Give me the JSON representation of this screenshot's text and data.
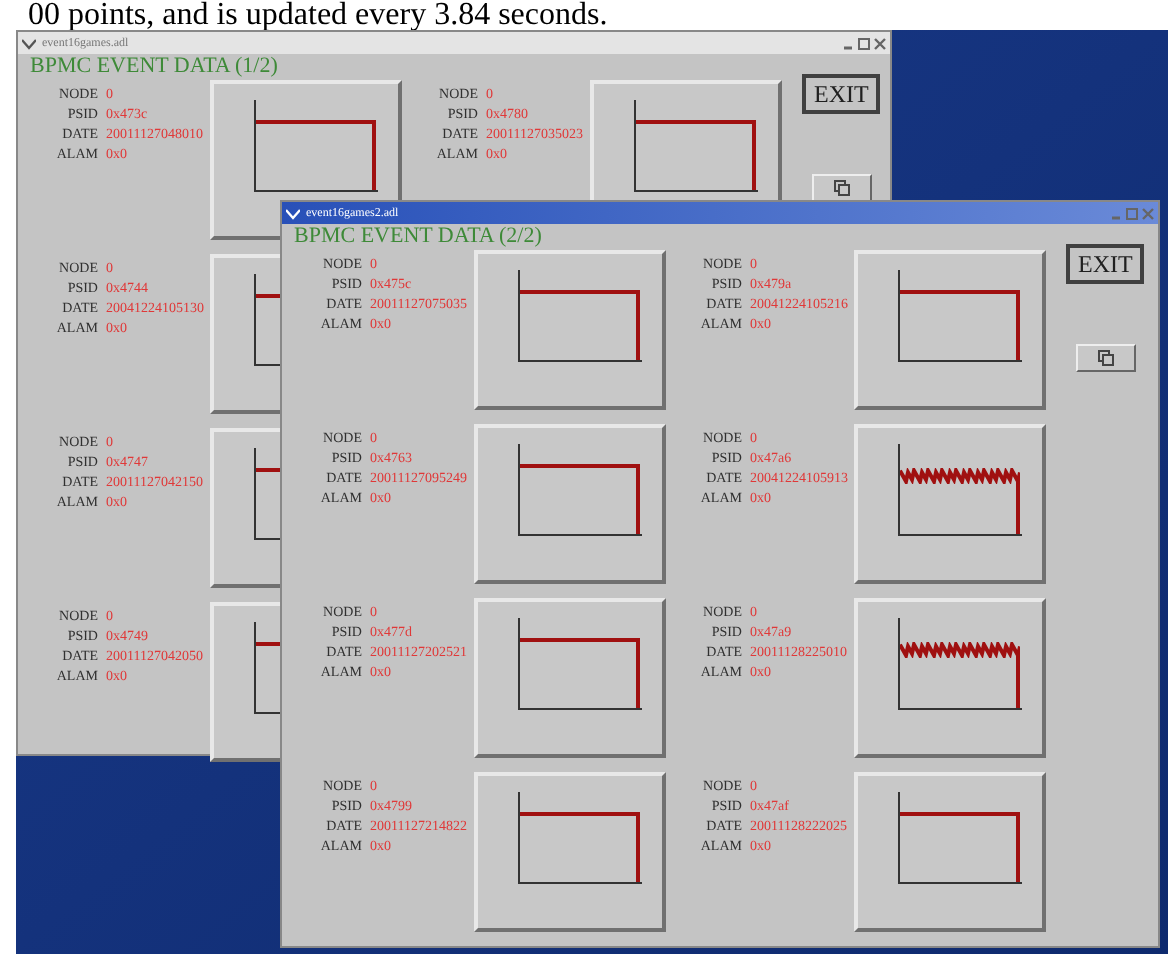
{
  "caption": "00 points, and is updated every 3.84 seconds.",
  "windows": [
    {
      "title": "event16games.adl",
      "active": false,
      "heading": "BPMC EVENT DATA (1/2)",
      "exit": "EXIT",
      "columns": [
        [
          {
            "labels": [
              "NODE",
              "PSID",
              "DATE",
              "ALAM"
            ],
            "values": [
              "0",
              "0x473c",
              "20011127048010",
              "0x0"
            ],
            "plot": {
              "kind": "flat"
            }
          },
          {
            "labels": [
              "NODE",
              "PSID",
              "DATE",
              "ALAM"
            ],
            "values": [
              "0",
              "0x4744",
              "20041224105130",
              "0x0"
            ],
            "plot": {
              "kind": "flat"
            }
          },
          {
            "labels": [
              "NODE",
              "PSID",
              "DATE",
              "ALAM"
            ],
            "values": [
              "0",
              "0x4747",
              "20011127042150",
              "0x0"
            ],
            "plot": {
              "kind": "flat"
            }
          },
          {
            "labels": [
              "NODE",
              "PSID",
              "DATE",
              "ALAM"
            ],
            "values": [
              "0",
              "0x4749",
              "20011127042050",
              "0x0"
            ],
            "plot": {
              "kind": "flat"
            }
          }
        ],
        [
          {
            "labels": [
              "NODE",
              "PSID",
              "DATE",
              "ALAM"
            ],
            "values": [
              "0",
              "0x4780",
              "20011127035023",
              "0x0"
            ],
            "plot": {
              "kind": "flat"
            }
          }
        ]
      ]
    },
    {
      "title": "event16games2.adl",
      "active": true,
      "heading": "BPMC EVENT DATA (2/2)",
      "exit": "EXIT",
      "columns": [
        [
          {
            "labels": [
              "NODE",
              "PSID",
              "DATE",
              "ALAM"
            ],
            "values": [
              "0",
              "0x475c",
              "20011127075035",
              "0x0"
            ],
            "plot": {
              "kind": "flat"
            }
          },
          {
            "labels": [
              "NODE",
              "PSID",
              "DATE",
              "ALAM"
            ],
            "values": [
              "0",
              "0x4763",
              "20011127095249",
              "0x0"
            ],
            "plot": {
              "kind": "flat"
            }
          },
          {
            "labels": [
              "NODE",
              "PSID",
              "DATE",
              "ALAM"
            ],
            "values": [
              "0",
              "0x477d",
              "20011127202521",
              "0x0"
            ],
            "plot": {
              "kind": "flat"
            }
          },
          {
            "labels": [
              "NODE",
              "PSID",
              "DATE",
              "ALAM"
            ],
            "values": [
              "0",
              "0x4799",
              "20011127214822",
              "0x0"
            ],
            "plot": {
              "kind": "flat"
            }
          }
        ],
        [
          {
            "labels": [
              "NODE",
              "PSID",
              "DATE",
              "ALAM"
            ],
            "values": [
              "0",
              "0x479a",
              "20041224105216",
              "0x0"
            ],
            "plot": {
              "kind": "flat"
            }
          },
          {
            "labels": [
              "NODE",
              "PSID",
              "DATE",
              "ALAM"
            ],
            "values": [
              "0",
              "0x47a6",
              "20041224105913",
              "0x0"
            ],
            "plot": {
              "kind": "noisy"
            }
          },
          {
            "labels": [
              "NODE",
              "PSID",
              "DATE",
              "ALAM"
            ],
            "values": [
              "0",
              "0x47a9",
              "20011128225010",
              "0x0"
            ],
            "plot": {
              "kind": "noisy"
            }
          },
          {
            "labels": [
              "NODE",
              "PSID",
              "DATE",
              "ALAM"
            ],
            "values": [
              "0",
              "0x47af",
              "20011128222025",
              "0x0"
            ],
            "plot": {
              "kind": "flat"
            }
          }
        ]
      ]
    }
  ]
}
